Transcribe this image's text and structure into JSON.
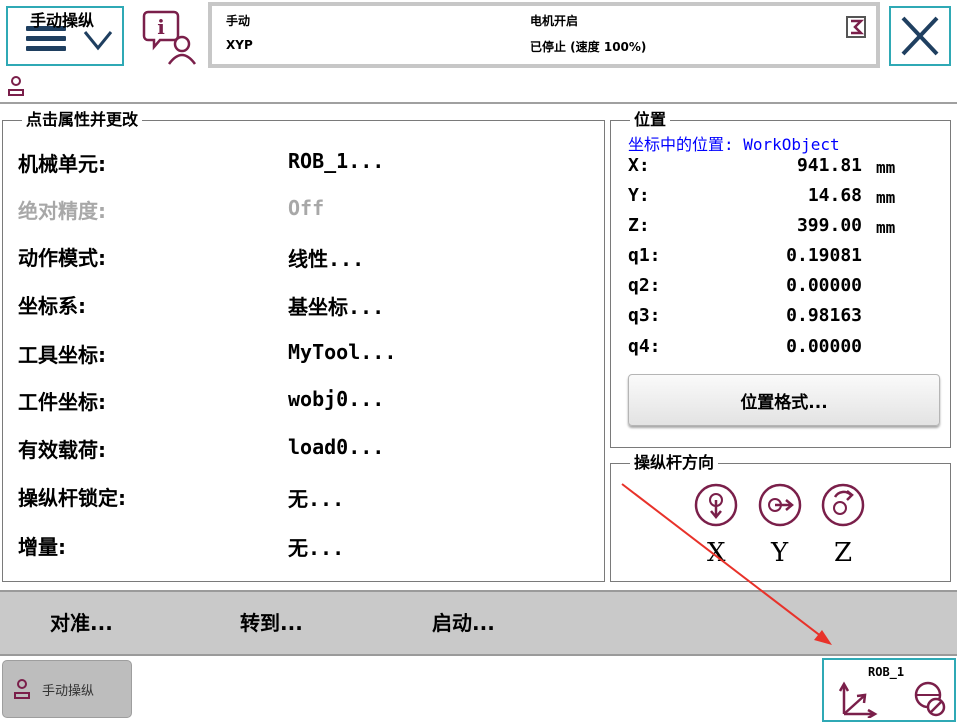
{
  "status": {
    "mode": "手动",
    "station": "XYP",
    "motor": "电机开启",
    "state": "已停止 (速度 100%)"
  },
  "title": "手动操纵",
  "properties": {
    "group_label": "点击属性并更改",
    "rows": [
      {
        "label": "机械单元:",
        "value": "ROB_1...",
        "disabled": false
      },
      {
        "label": "绝对精度:",
        "value": "Off",
        "disabled": true
      },
      {
        "label": "动作模式:",
        "value": "线性...",
        "disabled": false
      },
      {
        "label": "坐标系:",
        "value": "基坐标...",
        "disabled": false
      },
      {
        "label": "工具坐标:",
        "value": "MyTool...",
        "disabled": false
      },
      {
        "label": "工件坐标:",
        "value": "wobj0...",
        "disabled": false
      },
      {
        "label": "有效载荷:",
        "value": "load0...",
        "disabled": false
      },
      {
        "label": "操纵杆锁定:",
        "value": "无...",
        "disabled": false
      },
      {
        "label": "增量:",
        "value": "无...",
        "disabled": false
      }
    ]
  },
  "position": {
    "group_label": "位置",
    "subtitle": "坐标中的位置: WorkObject",
    "rows": [
      {
        "label": "X:",
        "value": "941.81",
        "unit": "mm"
      },
      {
        "label": "Y:",
        "value": "14.68",
        "unit": "mm"
      },
      {
        "label": "Z:",
        "value": "399.00",
        "unit": "mm"
      },
      {
        "label": "q1:",
        "value": "0.19081",
        "unit": ""
      },
      {
        "label": "q2:",
        "value": "0.00000",
        "unit": ""
      },
      {
        "label": "q3:",
        "value": "0.98163",
        "unit": ""
      },
      {
        "label": "q4:",
        "value": "0.00000",
        "unit": ""
      }
    ],
    "format_button": "位置格式..."
  },
  "joystick": {
    "group_label": "操纵杆方向",
    "axes": [
      "X",
      "Y",
      "Z"
    ]
  },
  "actions": {
    "align": "对准...",
    "goto": "转到...",
    "start": "启动..."
  },
  "taskbar": {
    "app_label": "手动操纵",
    "robot_name": "ROB_1"
  },
  "colors": {
    "accent_border": "#2fa9b5",
    "subtitle_blue": "#0000ff",
    "icon_purple": "#7a1f4a",
    "annotation_red": "#e8322a"
  },
  "icons": [
    "hamburger-icon",
    "chevron-down-icon",
    "info-user-icon",
    "motor-status-icon",
    "close-icon",
    "jog-person-icon",
    "joystick-x-icon",
    "joystick-y-icon",
    "joystick-z-icon",
    "coordinate-axes-icon",
    "no-increment-icon"
  ]
}
